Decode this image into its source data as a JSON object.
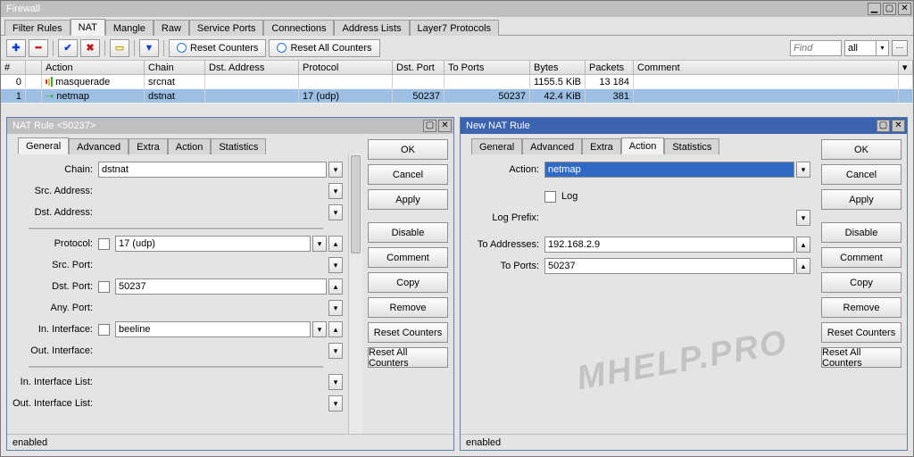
{
  "window": {
    "title": "Firewall"
  },
  "main_tabs": [
    "Filter Rules",
    "NAT",
    "Mangle",
    "Raw",
    "Service Ports",
    "Connections",
    "Address Lists",
    "Layer7 Protocols"
  ],
  "main_active_tab": "NAT",
  "toolbar": {
    "reset_counters": "Reset Counters",
    "reset_all_counters": "Reset All Counters",
    "find_placeholder": "Find",
    "filter_combo": "all"
  },
  "columns": {
    "num": "#",
    "action": "Action",
    "chain": "Chain",
    "dst_addr": "Dst. Address",
    "protocol": "Protocol",
    "dst_port": "Dst. Port",
    "to_ports": "To Ports",
    "bytes": "Bytes",
    "packets": "Packets",
    "comment": "Comment"
  },
  "rows": [
    {
      "num": "0",
      "action": "masquerade",
      "chain": "srcnat",
      "dst": "",
      "proto": "",
      "dport": "",
      "toports": "",
      "bytes": "1155.5 KiB",
      "packets": "13 184",
      "comment": "",
      "icon": "bars"
    },
    {
      "num": "1",
      "action": "netmap",
      "chain": "dstnat",
      "dst": "",
      "proto": "17 (udp)",
      "dport": "50237",
      "toports": "50237",
      "bytes": "42.4 KiB",
      "packets": "381",
      "comment": "",
      "icon": "arrow"
    }
  ],
  "left_panel": {
    "title": "NAT Rule <50237>",
    "tabs": [
      "General",
      "Advanced",
      "Extra",
      "Action",
      "Statistics"
    ],
    "active_tab": "General",
    "fields": {
      "chain_lbl": "Chain:",
      "chain": "dstnat",
      "src_addr_lbl": "Src. Address:",
      "src_addr": "",
      "dst_addr_lbl": "Dst. Address:",
      "dst_addr": "",
      "protocol_lbl": "Protocol:",
      "protocol": "17 (udp)",
      "src_port_lbl": "Src. Port:",
      "src_port": "",
      "dst_port_lbl": "Dst. Port:",
      "dst_port": "50237",
      "any_port_lbl": "Any. Port:",
      "any_port": "",
      "in_if_lbl": "In. Interface:",
      "in_if": "beeline",
      "out_if_lbl": "Out. Interface:",
      "out_if": "",
      "in_if_list_lbl": "In. Interface List:",
      "in_if_list": "",
      "out_if_list_lbl": "Out. Interface List:",
      "out_if_list": ""
    },
    "status": "enabled"
  },
  "right_panel": {
    "title": "New NAT Rule",
    "tabs": [
      "General",
      "Advanced",
      "Extra",
      "Action",
      "Statistics"
    ],
    "active_tab": "Action",
    "fields": {
      "action_lbl": "Action:",
      "action": "netmap",
      "log_lbl": "Log",
      "log_prefix_lbl": "Log Prefix:",
      "log_prefix": "",
      "to_addr_lbl": "To Addresses:",
      "to_addr": "192.168.2.9",
      "to_ports_lbl": "To Ports:",
      "to_ports": "50237"
    },
    "status": "enabled"
  },
  "buttons": {
    "ok": "OK",
    "cancel": "Cancel",
    "apply": "Apply",
    "disable": "Disable",
    "comment": "Comment",
    "copy": "Copy",
    "remove": "Remove",
    "reset_counters": "Reset Counters",
    "reset_all": "Reset All Counters"
  },
  "watermark": "MHELP.PRO"
}
